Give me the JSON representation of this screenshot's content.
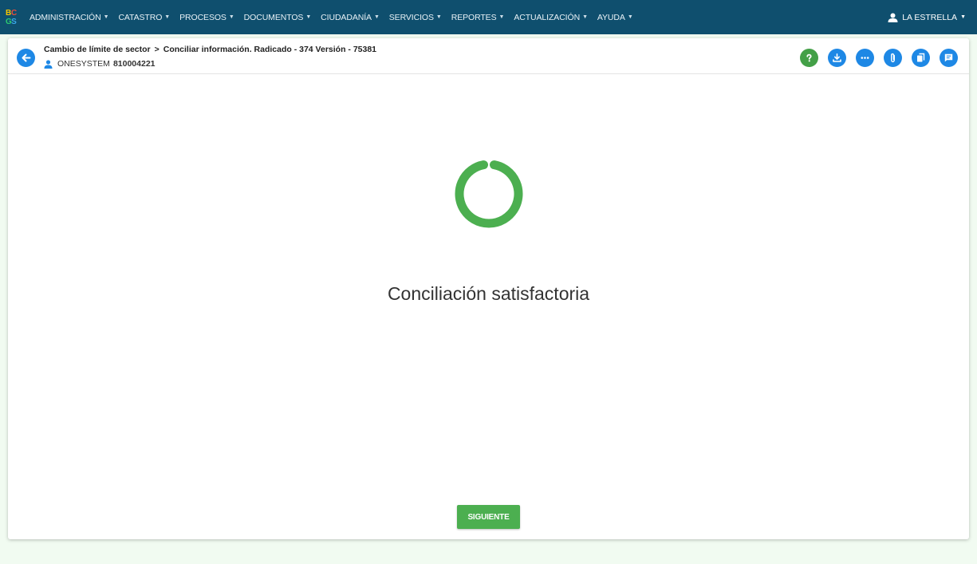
{
  "navbar": {
    "logo_letters": [
      "B",
      "C",
      "G",
      "S"
    ],
    "menu": [
      {
        "label": "ADMINISTRACIÓN"
      },
      {
        "label": "CATASTRO"
      },
      {
        "label": "PROCESOS"
      },
      {
        "label": "DOCUMENTOS"
      },
      {
        "label": "CIUDADANÍA"
      },
      {
        "label": "SERVICIOS"
      },
      {
        "label": "REPORTES"
      },
      {
        "label": "ACTUALIZACIÓN"
      },
      {
        "label": "AYUDA"
      }
    ],
    "user_label": "LA ESTRELLA",
    "background": "#0f4f6e"
  },
  "header": {
    "breadcrumb_parent": "Cambio de límite de sector",
    "breadcrumb_separator": ">",
    "breadcrumb_current": "Conciliar información. Radicado - 374 Versión - 75381",
    "owner_name": "ONESYSTEM",
    "owner_id": "810004221",
    "toolbar_icons": [
      "help-icon",
      "download-icon",
      "more-icon",
      "attachment-icon",
      "copy-icon",
      "comment-icon"
    ]
  },
  "main": {
    "message": "Conciliación satisfactoria",
    "next_button": "SIGUIENTE",
    "spinner_color": "#4caf50"
  },
  "colors": {
    "primary": "#1e88e5",
    "success": "#4caf50",
    "help": "#43a047"
  }
}
